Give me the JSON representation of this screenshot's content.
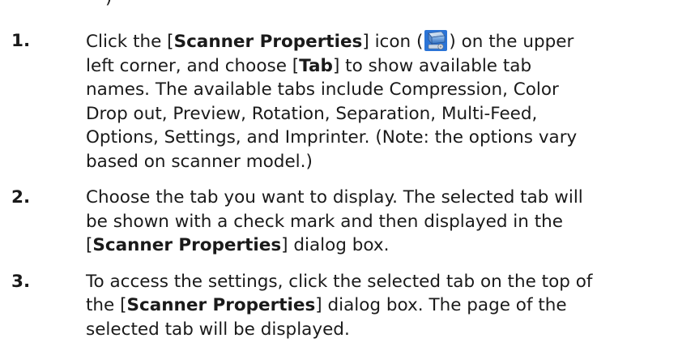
{
  "top_fragment": ")",
  "steps": [
    {
      "number": "1.",
      "line1": {
        "pre": "Click the [",
        "bold": "Scanner Properties",
        "mid": "] icon (",
        "icon": "scanner-properties-icon",
        "post": ") on the upper"
      },
      "line2": {
        "pre": "left corner, and choose [",
        "bold": "Tab",
        "post": "] to show available tab"
      },
      "line3": "names. The available tabs include Compression, Color",
      "line4": "Drop out, Preview, Rotation, Separation, Multi-Feed,",
      "line5": "Options, Settings, and Imprinter. (Note: the options vary",
      "line6": "based on scanner model.)"
    },
    {
      "number": "2.",
      "line1": "Choose the tab you want to display. The selected tab will",
      "line2": "be shown with a check mark and then displayed in the",
      "line3": {
        "pre": "[",
        "bold": "Scanner Properties",
        "post": "] dialog box."
      }
    },
    {
      "number": "3.",
      "line1": "To access the settings, click the selected tab on the top of",
      "line2": {
        "pre": "the [",
        "bold": "Scanner Properties",
        "post": "] dialog box. The page of the"
      },
      "line3": "selected tab will be displayed."
    }
  ]
}
